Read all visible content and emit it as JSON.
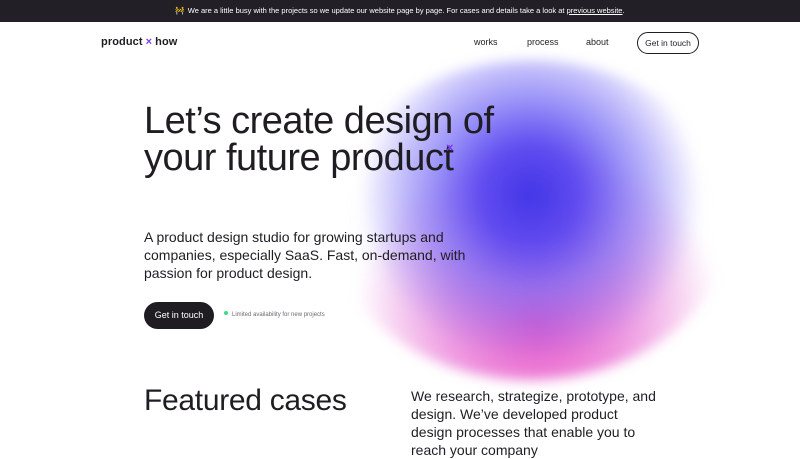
{
  "announcement": {
    "emoji": "🚧",
    "text": "We are a little busy with the projects so we update our website page by page. For cases and details take a look at",
    "link_text": "previous website",
    "suffix": "."
  },
  "header": {
    "logo_left": "product",
    "logo_mark": "×",
    "logo_right": "how",
    "nav": [
      "works",
      "process",
      "about"
    ],
    "cta": "Get in touch"
  },
  "hero": {
    "title": "Let’s create design of your future product",
    "mark": "×",
    "subtitle": "A product design studio for growing startups and companies, especially SaaS. Fast, on-demand, with passion for product design.",
    "cta": "Get in touch",
    "availability": "Limited availability for new projects"
  },
  "featured": {
    "title": "Featured cases",
    "text": "We research, strategize, prototype, and design. We’ve developed product design processes that enable you to reach your company"
  },
  "colors": {
    "accent": "#7a3cf0",
    "dark": "#1f1d22",
    "status": "#3ddc84"
  }
}
